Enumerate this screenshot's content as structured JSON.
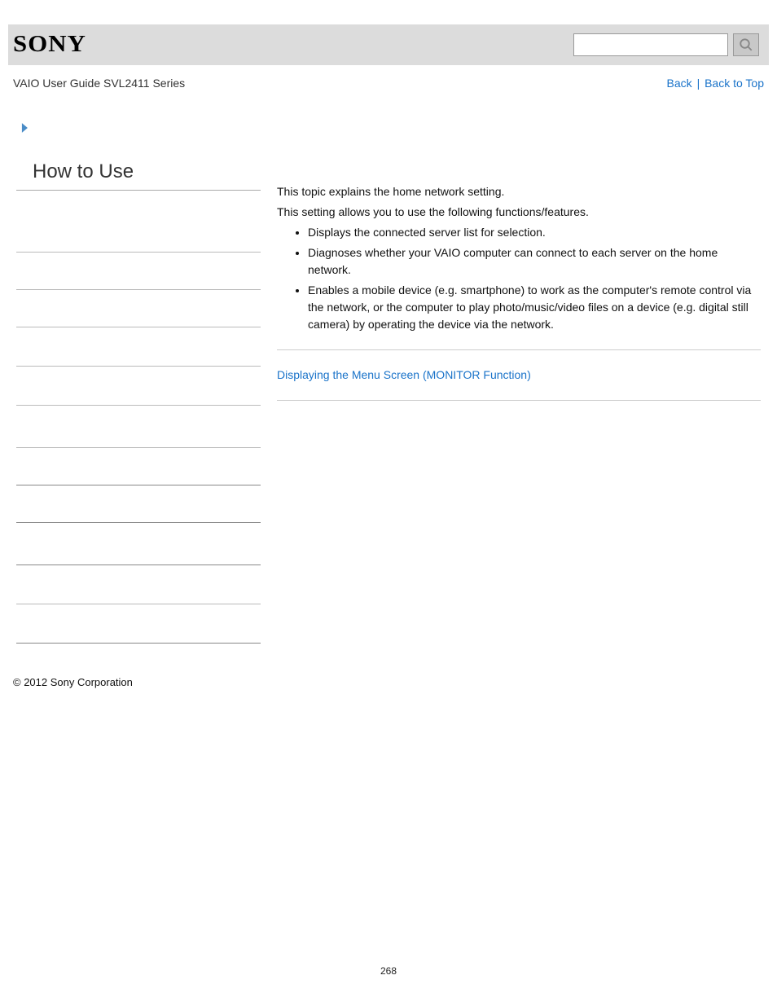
{
  "header": {
    "logo_text": "SONY",
    "guide_title": "VAIO User Guide SVL2411 Series",
    "back_label": "Back",
    "back_to_top_label": "Back to Top"
  },
  "sidebar": {
    "title": "How to Use",
    "item_count": 11
  },
  "content": {
    "para1": "This topic explains the home network setting.",
    "para2": "This setting allows you to use the following functions/features.",
    "bullets": [
      "Displays the connected server list for selection.",
      "Diagnoses whether your VAIO computer can connect to each server on the home network.",
      "Enables a mobile device (e.g. smartphone) to work as the computer's remote control via the network, or the computer to play photo/music/video files on a device (e.g. digital still camera) by operating the device via the network."
    ],
    "related_link": "Displaying the Menu Screen (MONITOR Function)"
  },
  "footer": {
    "copyright": "© 2012 Sony Corporation",
    "page_number": "268"
  }
}
